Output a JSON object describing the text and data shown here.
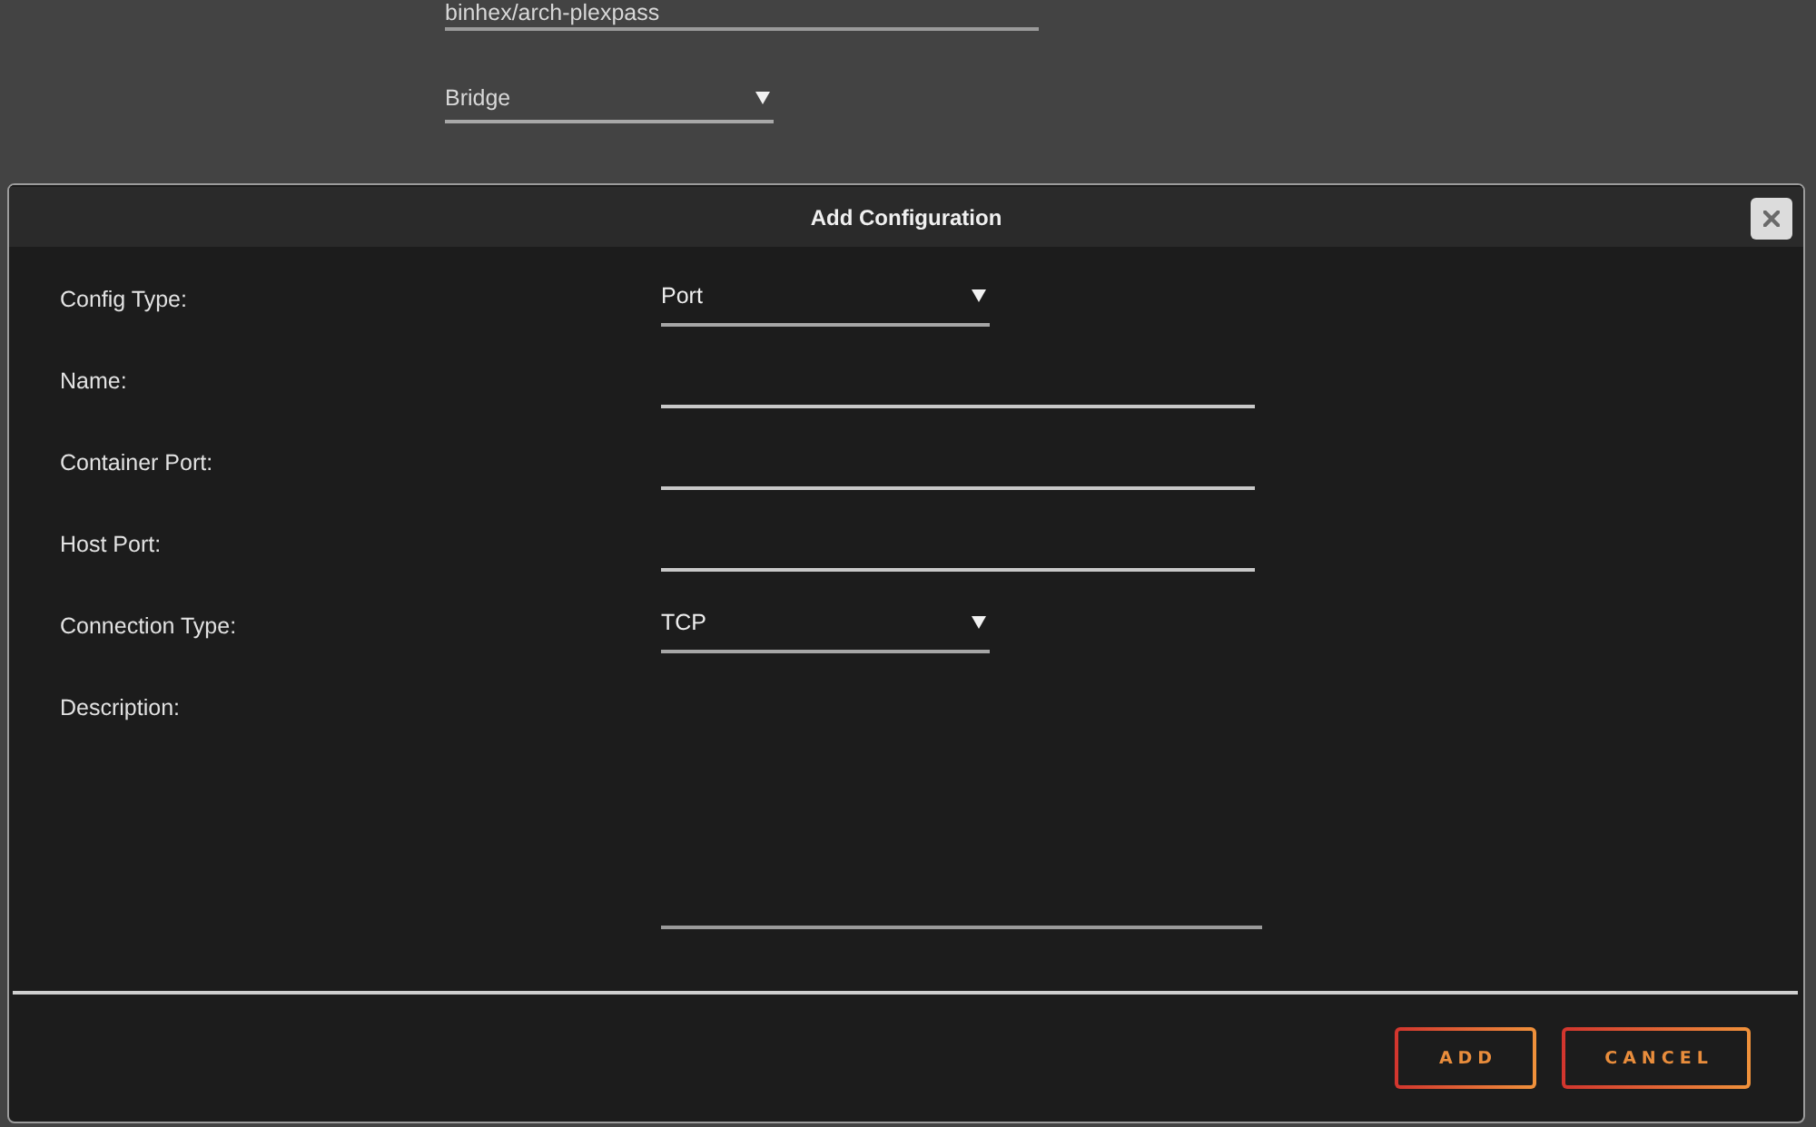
{
  "background_form": {
    "image_field": {
      "value": "binhex/arch-plexpass"
    },
    "network_select": {
      "value": "Bridge"
    }
  },
  "dialog": {
    "title": "Add Configuration",
    "fields": [
      {
        "label": "Config Type:",
        "kind": "select",
        "value": "Port"
      },
      {
        "label": "Name:",
        "kind": "text"
      },
      {
        "label": "Container Port:",
        "kind": "text"
      },
      {
        "label": "Host Port:",
        "kind": "text"
      },
      {
        "label": "Connection Type:",
        "kind": "select",
        "value": "TCP"
      },
      {
        "label": "Description:",
        "kind": "textarea"
      }
    ],
    "buttons": [
      "ADD",
      "CANCEL"
    ]
  }
}
